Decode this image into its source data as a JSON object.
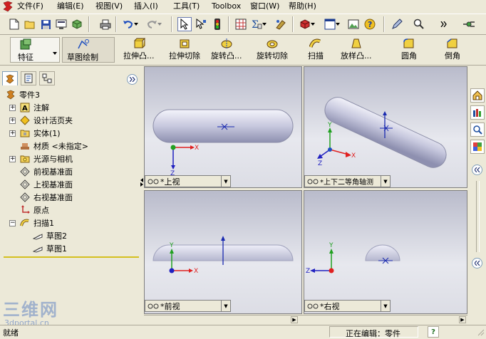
{
  "menu": [
    "文件(F)",
    "编辑(E)",
    "视图(V)",
    "插入(I)",
    "工具(T)",
    "Toolbox",
    "窗口(W)",
    "帮助(H)"
  ],
  "commands": {
    "feature_tab": "特征",
    "sketch_tab": "草图绘制",
    "extrude_boss": "拉伸凸...",
    "extrude_cut": "拉伸切除",
    "revolve_boss": "旋转凸...",
    "revolve_cut": "旋转切除",
    "sweep": "扫描",
    "loft": "放样凸...",
    "fillet": "圆角",
    "chamfer": "倒角"
  },
  "tree": {
    "root": "零件3",
    "items": [
      {
        "label": "注解",
        "expand": "+"
      },
      {
        "label": "设计活页夹",
        "expand": "+"
      },
      {
        "label": "实体(1)",
        "expand": "+"
      },
      {
        "label": "材质 <未指定>",
        "expand": ""
      },
      {
        "label": "光源与相机",
        "expand": "+"
      },
      {
        "label": "前视基准面",
        "expand": ""
      },
      {
        "label": "上视基准面",
        "expand": ""
      },
      {
        "label": "右视基准面",
        "expand": ""
      },
      {
        "label": "原点",
        "expand": ""
      },
      {
        "label": "扫描1",
        "expand": "−"
      },
      {
        "label": "草图2",
        "expand": ""
      },
      {
        "label": "草图1",
        "expand": ""
      }
    ]
  },
  "viewports": {
    "top": "*上视",
    "iso": "*上下二等角轴测",
    "front": "*前视",
    "right": "*右视"
  },
  "axes": {
    "x": "X",
    "y": "Y",
    "z": "Z"
  },
  "status": {
    "left": "就绪",
    "editing": "正在编辑：零件",
    "help": "?"
  },
  "watermark": {
    "line1": "三维网",
    "line2": "3dportal.cn"
  },
  "colors": {
    "x_axis": "#e02020",
    "y_axis": "#20a020",
    "z_axis": "#2020c0",
    "part": "#c9cbe0"
  }
}
